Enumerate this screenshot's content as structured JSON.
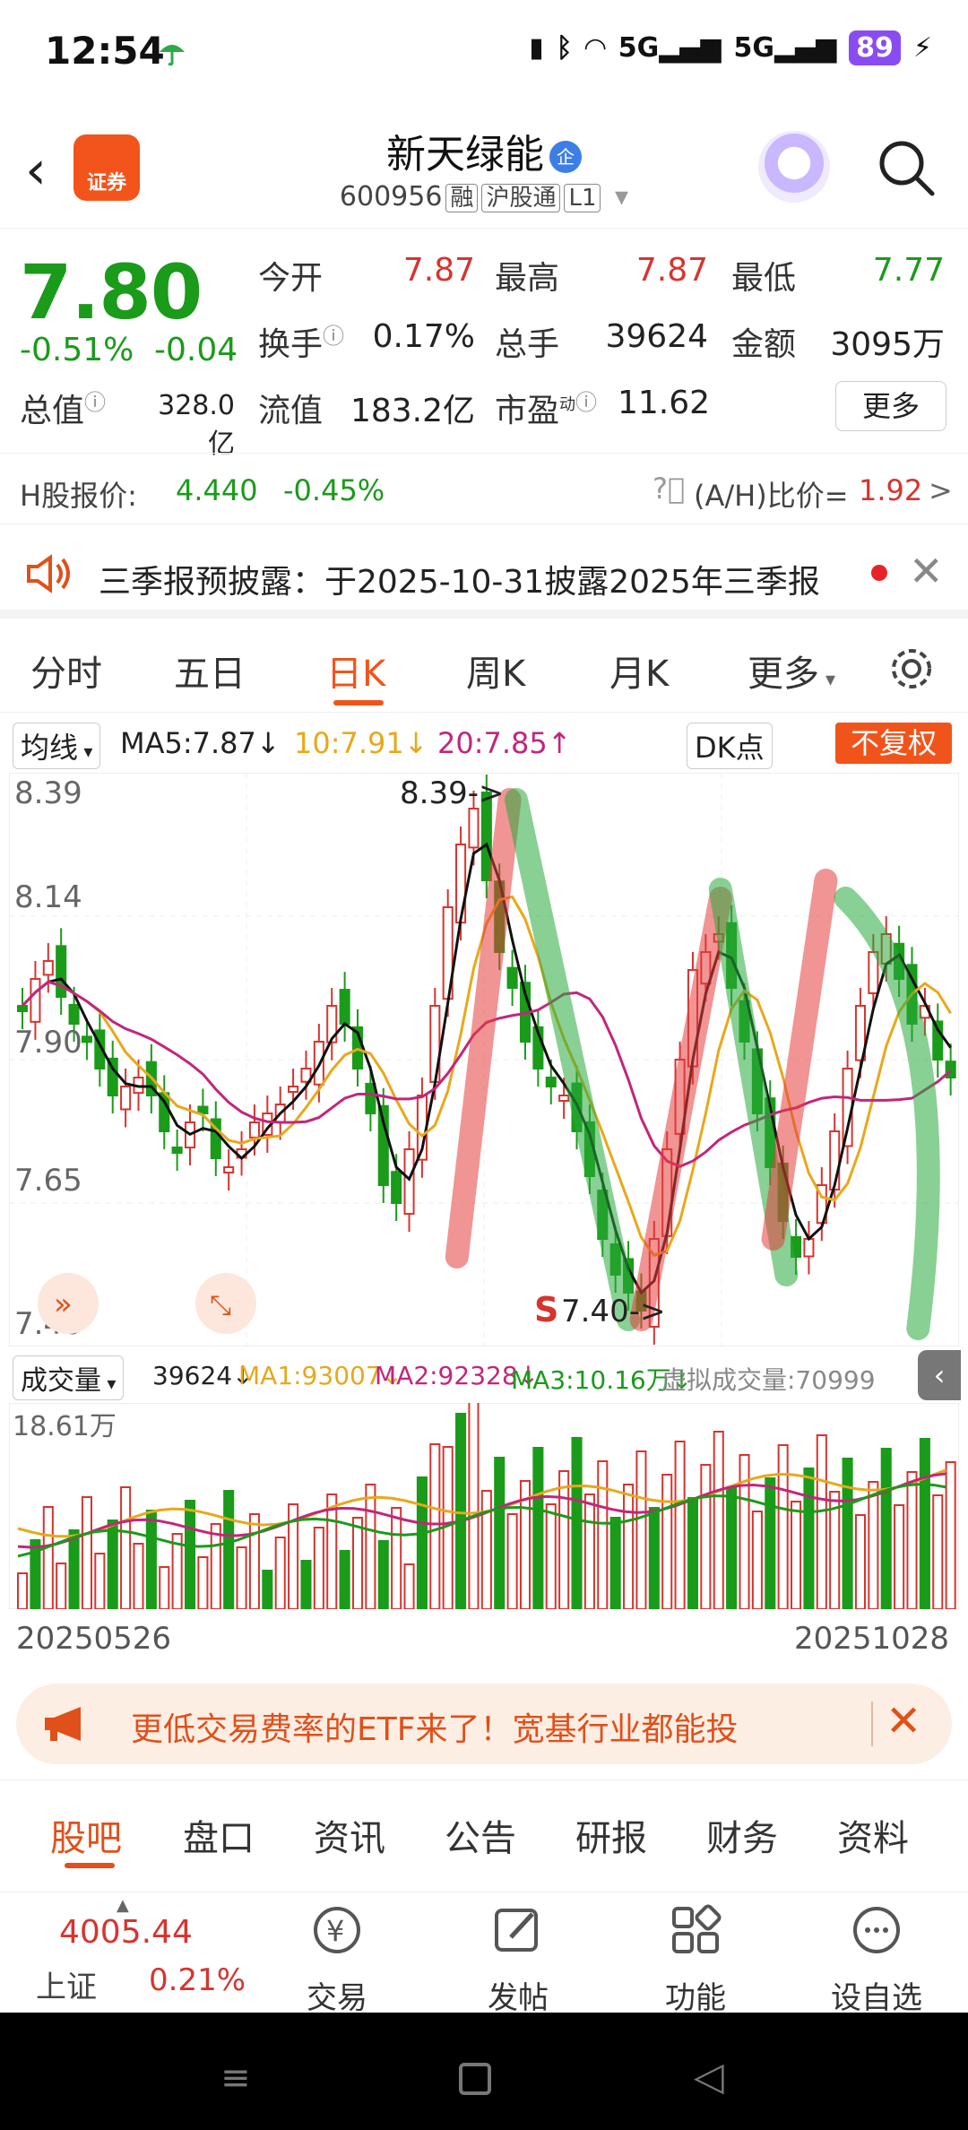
{
  "status": {
    "time": "12:54",
    "battery": "89",
    "net1": "5G",
    "net2": "5G"
  },
  "header": {
    "logo_text": "证券",
    "stock_name": "新天绿能",
    "qi_badge": "企",
    "code": "600956",
    "tag1": "融",
    "tag2": "沪股通",
    "tag3": "L1"
  },
  "quote": {
    "price": "7.80",
    "pct": "-0.51%",
    "chg": "-0.04",
    "open_label": "今开",
    "open": "7.87",
    "high_label": "最高",
    "high": "7.87",
    "low_label": "最低",
    "low": "7.77",
    "turnover_label": "换手",
    "turnover": "0.17%",
    "vol_label": "总手",
    "vol": "39624",
    "amount_label": "金额",
    "amount": "3095万",
    "mcap_label": "总值",
    "mcap": "328.0亿",
    "float_label": "流值",
    "float": "183.2亿",
    "pe_label": "市盈",
    "pe_sup": "动",
    "pe": "11.62",
    "more": "更多"
  },
  "hshare": {
    "label": "H股报价:",
    "price": "4.440",
    "pct": "-0.45%",
    "ah_label": "(A/H)比价=",
    "ah": "1.92",
    "arrow": ">"
  },
  "notice": {
    "text": "三季报预披露：于2025-10-31披露2025年三季报"
  },
  "tabs": [
    "分时",
    "五日",
    "日K",
    "周K",
    "月K",
    "更多"
  ],
  "ma_bar": {
    "selector": "均线",
    "ma5": "MA5:7.87",
    "ma10": "10:7.91",
    "ma20": "20:7.85",
    "dk": "DK点",
    "fq": "不复权"
  },
  "k_axis": {
    "y1": "8.39",
    "y2": "8.14",
    "y3": "7.90",
    "y4": "7.65",
    "y5": "7.40",
    "hi_note": "8.39->",
    "lo_letter": "S",
    "lo_note": "7.40->"
  },
  "vol_bar": {
    "selector": "成交量",
    "vol": "39624",
    "ma1": "MA1:93007",
    "ma2": "MA2:92328",
    "ma3": "MA3:10.16万",
    "virtual": "虚拟成交量:70999",
    "ymax": "18.61万"
  },
  "dates": {
    "start": "20250526",
    "end": "20251028"
  },
  "ad": {
    "text": "更低交易费率的ETF来了！宽基行业都能投"
  },
  "subtabs": [
    "股吧",
    "盘口",
    "资讯",
    "公告",
    "研报",
    "财务",
    "资料"
  ],
  "bottom": {
    "index_value": "4005.44",
    "index_name": "上证",
    "index_pct": "0.21%",
    "trade": "交易",
    "post": "发帖",
    "func": "功能",
    "watch": "设自选"
  },
  "colors": {
    "up": "#d6342f",
    "down": "#1a9b1a",
    "accent": "#f1541b"
  }
}
